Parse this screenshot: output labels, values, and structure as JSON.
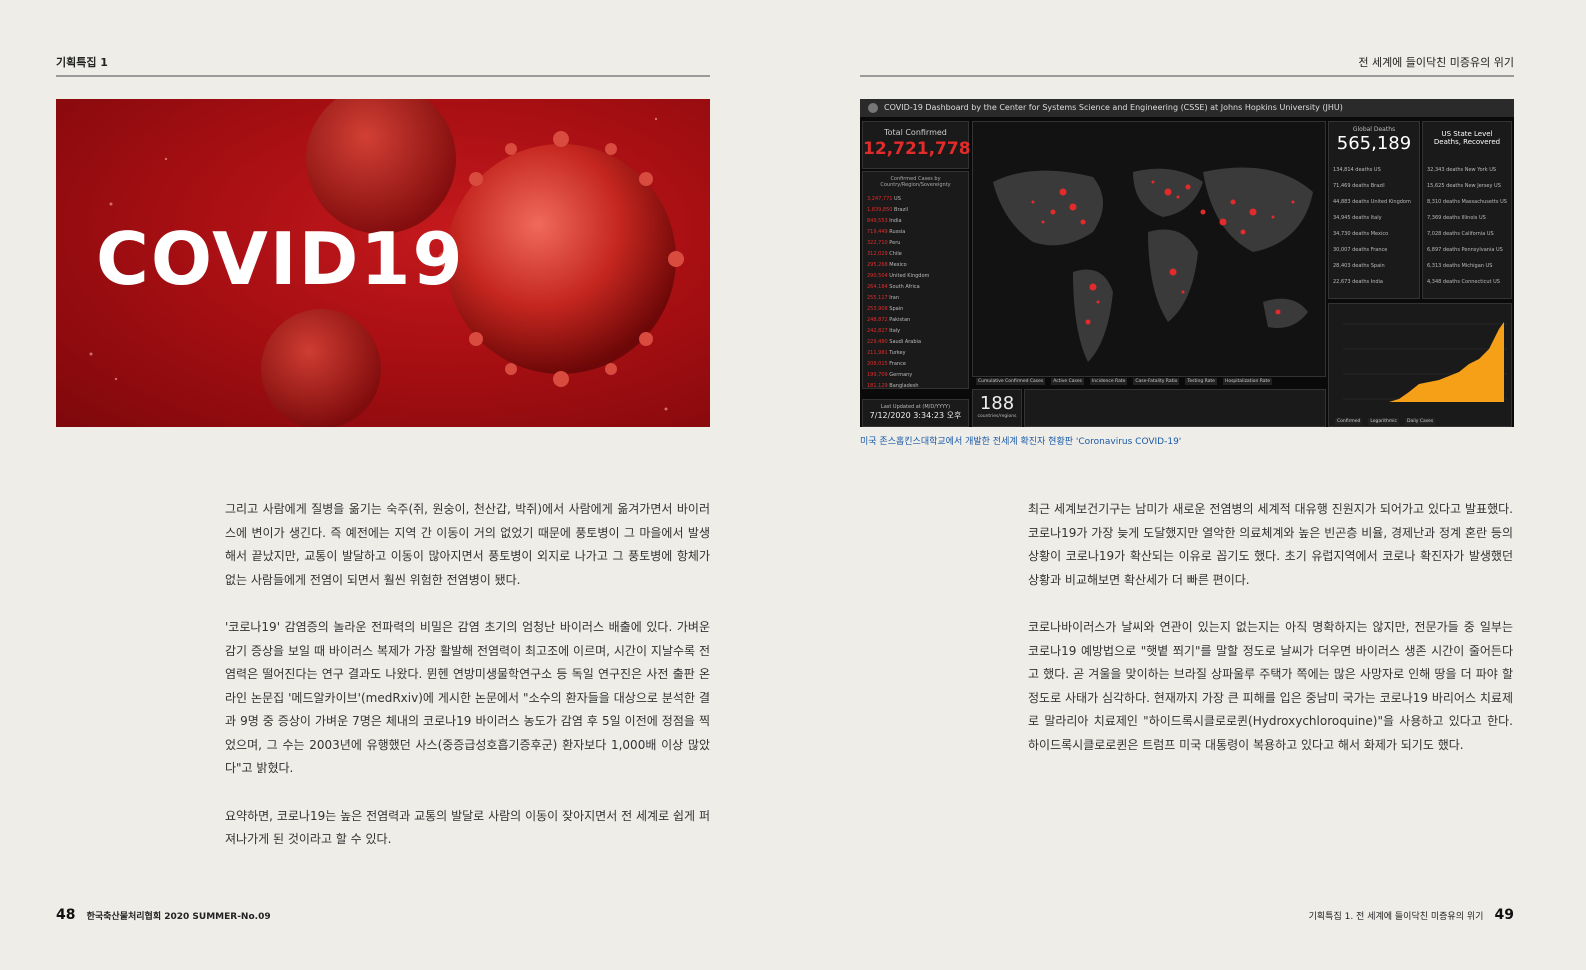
{
  "header": {
    "left": "기획특집 1",
    "right": "전 세계에 들이닥친 미증유의 위기"
  },
  "hero": {
    "title": "COVID19"
  },
  "dashboard": {
    "title": "COVID-19 Dashboard by the Center for Systems Science and Engineering (CSSE) at Johns Hopkins University (JHU)",
    "total_confirmed_label": "Total Confirmed",
    "total_confirmed": "12,721,778",
    "confirmed_by_label": "Confirmed Cases by Country/Region/Sovereignty",
    "countries": [
      {
        "v": "3,247,771",
        "n": "US"
      },
      {
        "v": "1,839,850",
        "n": "Brazil"
      },
      {
        "v": "849,553",
        "n": "India"
      },
      {
        "v": "719,449",
        "n": "Russia"
      },
      {
        "v": "322,710",
        "n": "Peru"
      },
      {
        "v": "312,029",
        "n": "Chile"
      },
      {
        "v": "295,268",
        "n": "Mexico"
      },
      {
        "v": "290,504",
        "n": "United Kingdom"
      },
      {
        "v": "264,184",
        "n": "South Africa"
      },
      {
        "v": "255,117",
        "n": "Iran"
      },
      {
        "v": "253,908",
        "n": "Spain"
      },
      {
        "v": "248,872",
        "n": "Pakistan"
      },
      {
        "v": "242,827",
        "n": "Italy"
      },
      {
        "v": "229,480",
        "n": "Saudi Arabia"
      },
      {
        "v": "211,981",
        "n": "Turkey"
      },
      {
        "v": "208,015",
        "n": "France"
      },
      {
        "v": "199,709",
        "n": "Germany"
      },
      {
        "v": "181,129",
        "n": "Bangladesh"
      }
    ],
    "last_updated_label": "Last Updated at (M/D/YYYY)",
    "last_updated": "7/12/2020 3:34:23 오후",
    "countries_count": "188",
    "countries_label": "countries/regions",
    "global_deaths_label": "Global Deaths",
    "global_deaths": "565,189",
    "deaths": [
      {
        "v": "134,814 deaths",
        "n": "US"
      },
      {
        "v": "71,469 deaths",
        "n": "Brazil"
      },
      {
        "v": "44,883 deaths",
        "n": "United Kingdom"
      },
      {
        "v": "34,945 deaths",
        "n": "Italy"
      },
      {
        "v": "34,730 deaths",
        "n": "Mexico"
      },
      {
        "v": "30,007 deaths",
        "n": "France"
      },
      {
        "v": "28,403 deaths",
        "n": "Spain"
      },
      {
        "v": "22,673 deaths",
        "n": "India"
      }
    ],
    "us_label": "US State Level Deaths, Recovered",
    "us_states": [
      {
        "v": "32,343 deaths",
        "n": "New York US"
      },
      {
        "v": "15,625 deaths",
        "n": "New Jersey US"
      },
      {
        "v": "8,310 deaths",
        "n": "Massachusetts US"
      },
      {
        "v": "7,369 deaths",
        "n": "Illinois US"
      },
      {
        "v": "7,028 deaths",
        "n": "California US"
      },
      {
        "v": "6,897 deaths",
        "n": "Pennsylvania US"
      },
      {
        "v": "6,313 deaths",
        "n": "Michigan US"
      },
      {
        "v": "4,348 deaths",
        "n": "Connecticut US"
      }
    ],
    "map_tabs": [
      "Cumulative Confirmed Cases",
      "Active Cases",
      "Incidence Rate",
      "Case-Fatality Ratio",
      "Testing Rate",
      "Hospitalization Rate"
    ],
    "chart_tabs": [
      "Confirmed",
      "Logarithmic",
      "Daily Cases"
    ]
  },
  "caption": "미국 존스홉킨스대학교에서 개발한 전세계 확진자 현황판 'Coronavirus COVID-19'",
  "left_paragraphs": [
    "그리고 사람에게 질병을 옮기는 숙주(쥐, 원숭이, 천산갑, 박쥐)에서 사람에게 옮겨가면서 바이러스에 변이가 생긴다. 즉 예전에는 지역 간 이동이 거의 없었기 때문에 풍토병이 그 마을에서 발생해서 끝났지만, 교통이 발달하고 이동이 많아지면서 풍토병이 외지로 나가고 그 풍토병에 항체가 없는 사람들에게 전염이 되면서 훨씬 위험한 전염병이 됐다.",
    "'코로나19' 감염증의 놀라운 전파력의 비밀은 감염 초기의 엄청난 바이러스 배출에 있다. 가벼운 감기 증상을 보일 때 바이러스 복제가 가장 활발해 전염력이 최고조에 이르며, 시간이 지날수록 전염력은 떨어진다는 연구 결과도 나왔다. 뮌헨 연방미생물학연구소 등 독일 연구진은 사전 출판 온라인 논문집 '메드알카이브'(medRxiv)에 게시한 논문에서 \"소수의 환자들을 대상으로 분석한 결과 9명 중 증상이 가벼운 7명은 체내의 코로나19 바이러스 농도가 감염 후 5일 이전에 정점을 찍었으며, 그 수는 2003년에 유행했던 사스(중증급성호흡기증후군) 환자보다 1,000배 이상 많았다\"고 밝혔다.",
    "요약하면, 코로나19는 높은 전염력과 교통의 발달로 사람의 이동이 잦아지면서 전 세계로 쉽게 퍼져나가게 된 것이라고 할 수 있다."
  ],
  "right_paragraphs": [
    "최근 세계보건기구는 남미가 새로운 전염병의 세계적 대유행 진원지가 되어가고 있다고 발표했다. 코로나19가 가장 늦게 도달했지만 열악한 의료체계와 높은 빈곤층 비율, 경제난과 정계 혼란 등의 상황이 코로나19가 확산되는 이유로 꼽기도 했다. 초기 유럽지역에서 코로나 확진자가 발생했던 상황과 비교해보면 확산세가 더 빠른 편이다.",
    "코로나바이러스가 날씨와 연관이 있는지 없는지는 아직 명확하지는 않지만, 전문가들 중 일부는 코로나19 예방법으로 \"햇볕 쬐기\"를 말할 정도로 날씨가 더우면 바이러스 생존 시간이 줄어든다고 했다. 곧 겨울을 맞이하는 브라질 상파울루 주택가 쪽에는 많은 사망자로 인해 땅을 더 파야 할 정도로 사태가 심각하다. 현재까지 가장 큰 피해를 입은 중남미 국가는 코로나19 바리어스 치료제로 말라리아 치료제인 \"하이드록시클로로퀸(Hydroxychloroquine)\"을 사용하고 있다고 한다. 하이드록시클로로퀸은 트럼프 미국 대통령이 복용하고 있다고 해서 화제가 되기도 했다."
  ],
  "footer": {
    "left_page": "48",
    "left_text": "한국축산물처리협회 2020 SUMMER-No.09",
    "right_text": "기획특집 1. 전 세계에 들이닥친 미증유의 위기",
    "right_page": "49"
  }
}
